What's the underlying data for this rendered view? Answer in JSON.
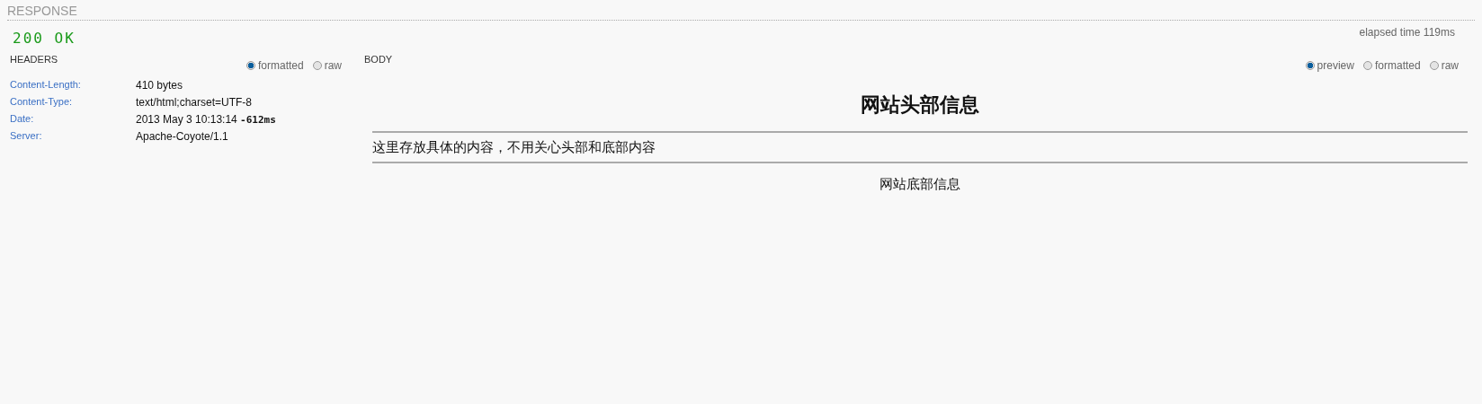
{
  "section_title": "RESPONSE",
  "status": "200 OK",
  "elapsed": "elapsed time 119ms",
  "headers": {
    "title": "HEADERS",
    "modes": [
      {
        "label": "formatted",
        "selected": true
      },
      {
        "label": "raw",
        "selected": false
      }
    ],
    "rows": [
      {
        "name": "Content-Length:",
        "value": "410 bytes"
      },
      {
        "name": "Content-Type:",
        "value": "text/html;charset=UTF-8"
      },
      {
        "name": "Date:",
        "value": "2013 May 3 10:13:14 **-612ms**"
      },
      {
        "name": "Server:",
        "value": "Apache-Coyote/1.1"
      }
    ]
  },
  "body": {
    "title": "BODY",
    "modes": [
      {
        "label": "preview",
        "selected": true
      },
      {
        "label": "formatted",
        "selected": false
      },
      {
        "label": "raw",
        "selected": false
      }
    ],
    "preview": {
      "heading": "网站头部信息",
      "content": "这里存放具体的内容，不用关心头部和底部内容",
      "footer": "网站底部信息"
    }
  }
}
